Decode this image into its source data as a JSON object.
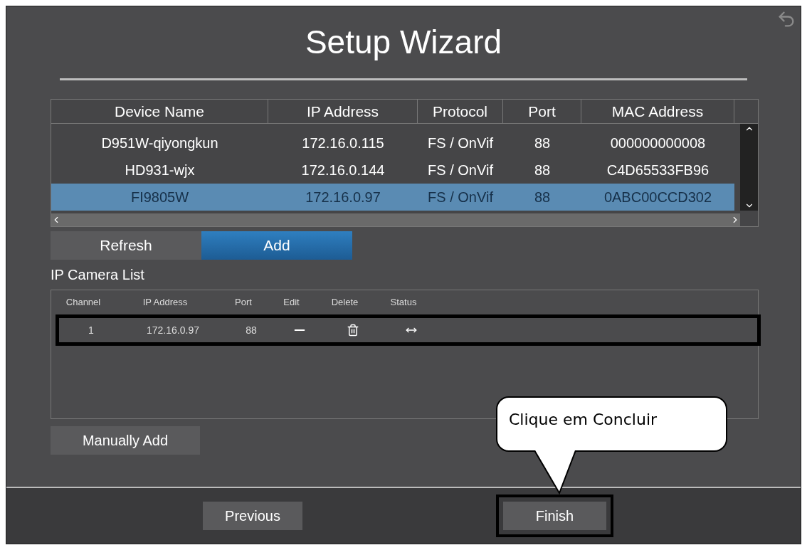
{
  "window": {
    "title": "Setup Wizard"
  },
  "device_table": {
    "columns": [
      "Device Name",
      "IP Address",
      "Protocol",
      "Port",
      "MAC Address"
    ],
    "rows": [
      {
        "cells": [
          "D951W-qiyongkun",
          "172.16.0.115",
          "FS / OnVif",
          "88",
          "000000000008"
        ],
        "selected": false
      },
      {
        "cells": [
          "HD931-wjx",
          "172.16.0.144",
          "FS / OnVif",
          "88",
          "C4D65533FB96"
        ],
        "selected": false
      },
      {
        "cells": [
          "FI9805W",
          "172.16.0.97",
          "FS / OnVif",
          "88",
          "0ABC00CCD302"
        ],
        "selected": true
      }
    ]
  },
  "buttons": [
    {
      "label": "Refresh",
      "selected": false
    },
    {
      "label": "Add",
      "selected": true
    }
  ],
  "camera_list": {
    "title": "IP Camera List",
    "columns": [
      "Channel",
      "IP Address",
      "Port",
      "Edit",
      "Delete",
      "Status"
    ],
    "rows": [
      {
        "channel": "1",
        "ip": "172.16.0.97",
        "port": "88",
        "highlighted": true
      }
    ]
  },
  "manual_add_button": "Manually Add",
  "footer": {
    "previous": "Previous",
    "finish": "Finish",
    "finish_highlighted": true
  },
  "callout": {
    "text": "Clique em Concluir"
  }
}
